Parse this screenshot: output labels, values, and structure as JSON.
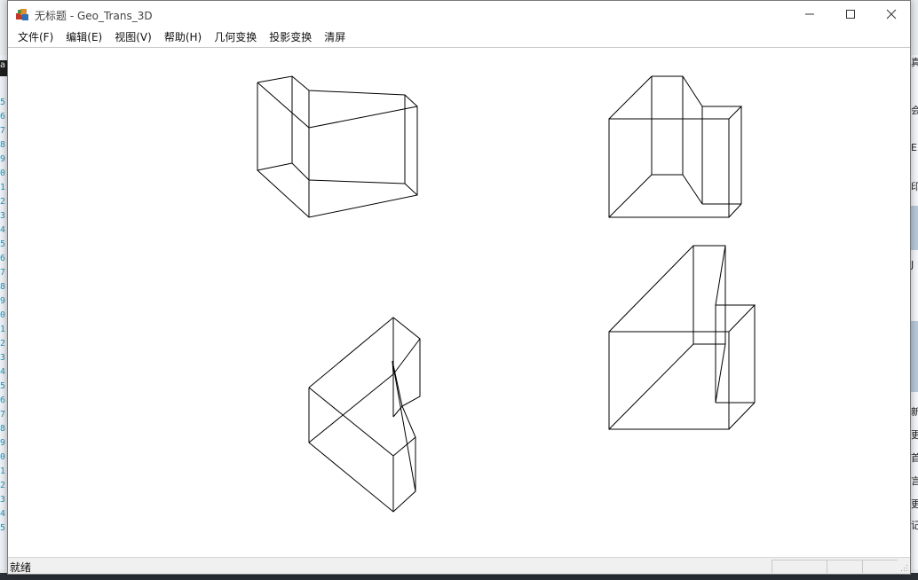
{
  "window": {
    "title": "无标题 - Geo_Trans_3D",
    "minimize_icon": "minimize-icon",
    "maximize_icon": "maximize-icon",
    "close_icon": "close-icon",
    "app_icon": "geo-trans-app-icon"
  },
  "menu": [
    {
      "label": "文件(F)"
    },
    {
      "label": "编辑(E)"
    },
    {
      "label": "视图(V)"
    },
    {
      "label": "帮助(H)"
    },
    {
      "label": "几何变换"
    },
    {
      "label": "投影变换"
    },
    {
      "label": "清屏"
    }
  ],
  "status": {
    "text": "就绪"
  },
  "background": {
    "left_gutter": [
      "5",
      "6",
      "7",
      "8",
      "9",
      "0",
      "1",
      "2",
      "3",
      "4",
      "5",
      "6",
      "7",
      "8",
      "9",
      "0",
      "1",
      "2",
      "3",
      "4",
      "5",
      "6",
      "7",
      "8",
      "9",
      "0",
      "1",
      "2",
      "3",
      "4",
      "5"
    ],
    "left_tag": "a",
    "right_chars": [
      "真",
      "会",
      "E",
      "印",
      "J",
      "新",
      "更",
      "首",
      "言",
      "更",
      "记"
    ]
  },
  "colors": {
    "canvas": "#ffffff",
    "stroke": "#000000",
    "statusbar": "#f0f0f0"
  }
}
